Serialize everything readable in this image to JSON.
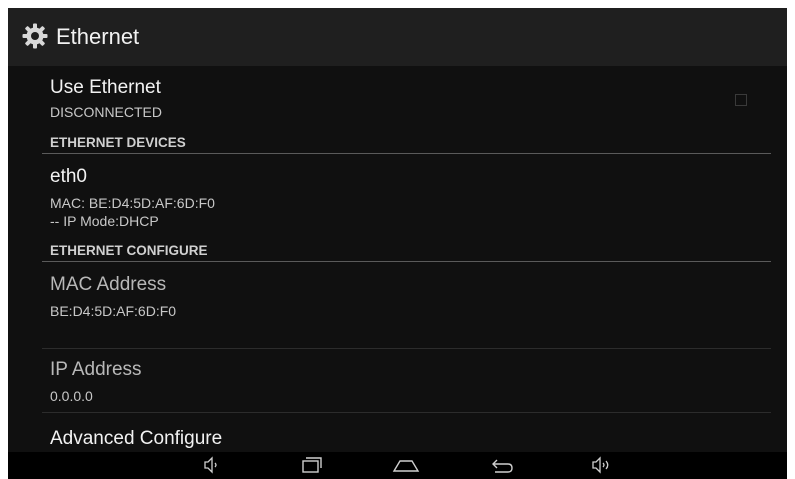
{
  "action_bar": {
    "icon": "gear-icon",
    "title": "Ethernet"
  },
  "use_ethernet": {
    "title": "Use Ethernet",
    "summary": "DISCONNECTED",
    "checked": false
  },
  "devices": {
    "header": "ETHERNET DEVICES",
    "items": [
      {
        "title": "eth0",
        "mac_line": "MAC: BE:D4:5D:AF:6D:F0",
        "mode_line": "-- IP Mode:DHCP"
      }
    ]
  },
  "configure": {
    "header": "ETHERNET CONFIGURE",
    "mac_address": {
      "title": "MAC Address",
      "value": "BE:D4:5D:AF:6D:F0"
    },
    "ip_address": {
      "title": "IP Address",
      "value": "0.0.0.0"
    },
    "advanced": {
      "title": "Advanced Configure"
    }
  },
  "navbar": {
    "buttons": [
      "volume-down-icon",
      "recent-apps-icon",
      "home-icon",
      "back-icon",
      "volume-up-icon"
    ]
  },
  "colors": {
    "background": "#101010",
    "action_bar": "#1f1f1f",
    "text_primary": "#f2f2f2",
    "text_secondary": "#c8c8c8"
  }
}
